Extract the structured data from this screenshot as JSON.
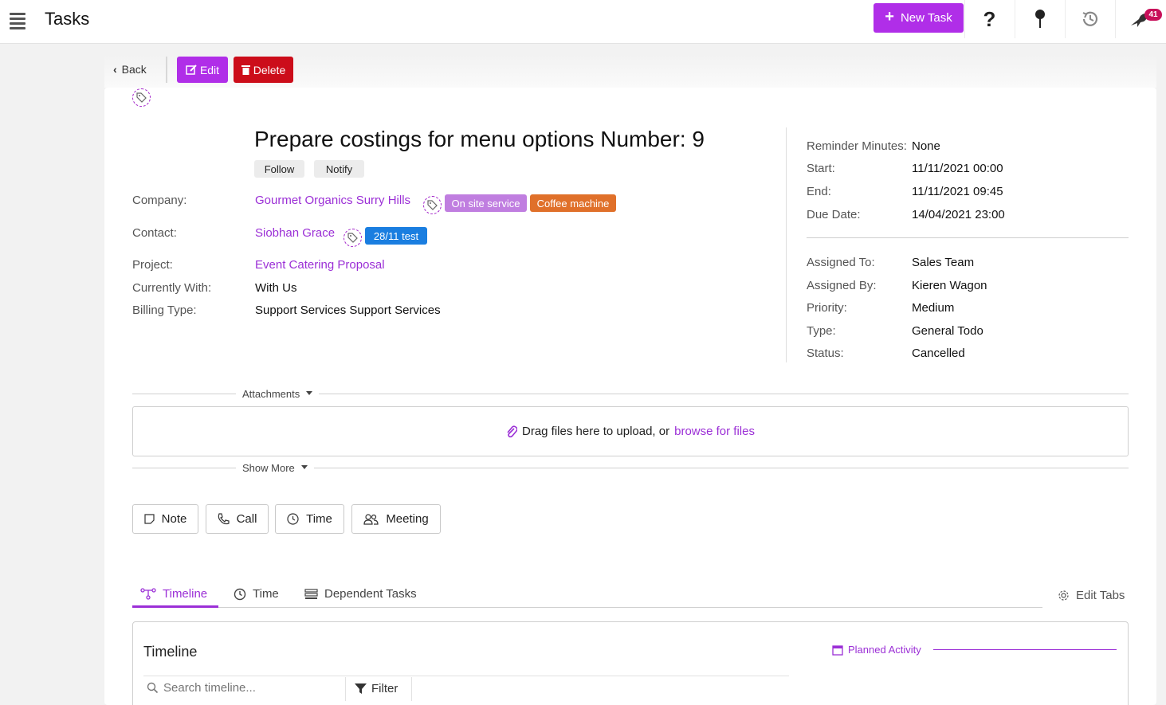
{
  "header": {
    "app_title": "Tasks",
    "new_task_label": "New Task",
    "notification_count": "41",
    "icons": [
      "menu-icon",
      "help-icon",
      "pin-icon",
      "history-icon",
      "bird-icon"
    ]
  },
  "actions": {
    "back_label": "Back",
    "edit_label": "Edit",
    "delete_label": "Delete"
  },
  "task": {
    "title": "Prepare costings for menu options Number: 9",
    "follow_label": "Follow",
    "notify_label": "Notify"
  },
  "details": {
    "company": {
      "label": "Company:",
      "value": "Gourmet Organics Surry Hills",
      "tags": [
        "On site service",
        "Coffee machine"
      ]
    },
    "contact": {
      "label": "Contact:",
      "value": "Siobhan Grace",
      "tags": [
        "28/11 test"
      ]
    },
    "project": {
      "label": "Project:",
      "value": "Event Catering Proposal"
    },
    "currently_with": {
      "label": "Currently With:",
      "value": "With Us"
    },
    "billing_type": {
      "label": "Billing Type:",
      "value": "Support Services Support Services"
    }
  },
  "side": {
    "reminder": {
      "label": "Reminder Minutes:",
      "value": "None"
    },
    "start": {
      "label": "Start:",
      "value": "11/11/2021 00:00"
    },
    "end": {
      "label": "End:",
      "value": "11/11/2021 09:45"
    },
    "due": {
      "label": "Due Date:",
      "value": "14/04/2021 23:00"
    },
    "assigned_to": {
      "label": "Assigned To:",
      "value": "Sales Team"
    },
    "assigned_by": {
      "label": "Assigned By:",
      "value": "Kieren Wagon"
    },
    "priority": {
      "label": "Priority:",
      "value": "Medium"
    },
    "type": {
      "label": "Type:",
      "value": "General Todo"
    },
    "status": {
      "label": "Status:",
      "value": "Cancelled"
    }
  },
  "attachments": {
    "section_label": "Attachments",
    "drop_text": "Drag files here to upload, or",
    "browse_link": "browse for files",
    "show_more_label": "Show More"
  },
  "quick_actions": [
    "Note",
    "Call",
    "Time",
    "Meeting"
  ],
  "tabs": {
    "items": [
      "Timeline",
      "Time",
      "Dependent Tasks"
    ],
    "active": "Timeline",
    "edit_tabs_label": "Edit Tabs"
  },
  "timeline": {
    "heading": "Timeline",
    "planned_activity_label": "Planned Activity",
    "search_placeholder": "Search timeline...",
    "filter_label": "Filter"
  },
  "colors": {
    "accent": "#b02ee8",
    "link": "#9b2fd6",
    "danger": "#cc0d1a",
    "tag_on_site": "#c07ee0",
    "tag_coffee": "#e0702a",
    "tag_test": "#1a7ee0"
  }
}
